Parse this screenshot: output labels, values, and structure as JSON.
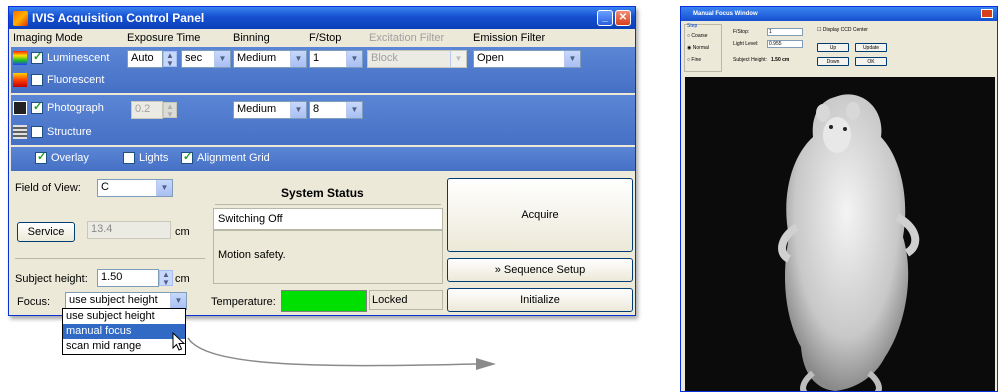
{
  "window": {
    "title": "IVIS Acquisition Control Panel",
    "min_label": "_",
    "close_label": "✕"
  },
  "headers": {
    "imaging_mode": "Imaging Mode",
    "exposure_time": "Exposure Time",
    "binning": "Binning",
    "fstop": "F/Stop",
    "excitation_filter": "Excitation Filter",
    "emission_filter": "Emission Filter"
  },
  "luminescent": {
    "label": "Luminescent",
    "checked": true,
    "exposure": "Auto",
    "unit": "sec",
    "binning": "Medium",
    "fstop": "1",
    "excitation": "Block",
    "emission": "Open"
  },
  "fluorescent": {
    "label": "Fluorescent",
    "checked": false
  },
  "photograph": {
    "label": "Photograph",
    "checked": true,
    "exposure": "0.2",
    "binning": "Medium",
    "fstop": "8"
  },
  "structure": {
    "label": "Structure",
    "checked": false
  },
  "overlay_row": {
    "overlay": "Overlay",
    "lights": "Lights",
    "alignment_grid": "Alignment Grid"
  },
  "field_of_view": {
    "label": "Field of View:",
    "value": "C"
  },
  "service": {
    "button": "Service",
    "value": "13.4",
    "unit": "cm"
  },
  "subject_height": {
    "label": "Subject height:",
    "value": "1.50",
    "unit": "cm"
  },
  "focus": {
    "label": "Focus:",
    "value": "use subject height",
    "options": [
      "use subject height",
      "manual focus",
      "scan mid range"
    ],
    "highlighted": "manual focus"
  },
  "system_status": {
    "title": "System Status",
    "line1": "Switching Off",
    "line2": "Motion safety."
  },
  "temperature": {
    "label": "Temperature:",
    "status": "Locked",
    "color": "#00e000"
  },
  "buttons": {
    "acquire": "Acquire",
    "sequence_setup": "Sequence Setup",
    "sequence_icon": "»",
    "initialize": "Initialize"
  },
  "manual_focus_window": {
    "title": "Manual Focus Window",
    "step_label": "Step",
    "steps": [
      "Coarse",
      "Normal",
      "Fine"
    ],
    "fstop_label": "F/Stop:",
    "fstop_value": "1",
    "light_label": "Light Level:",
    "light_value": "0.955",
    "subject_height_label": "Subject Height:",
    "subject_height_value": "1.50 cm",
    "display_ccd": "Display CCD Center",
    "up": "Up",
    "update": "Update",
    "down": "Down",
    "ok": "OK"
  },
  "colors": {
    "title_blue": "#1650d0",
    "panel_blue": "#4f7acb",
    "temperature_green": "#00e000"
  }
}
